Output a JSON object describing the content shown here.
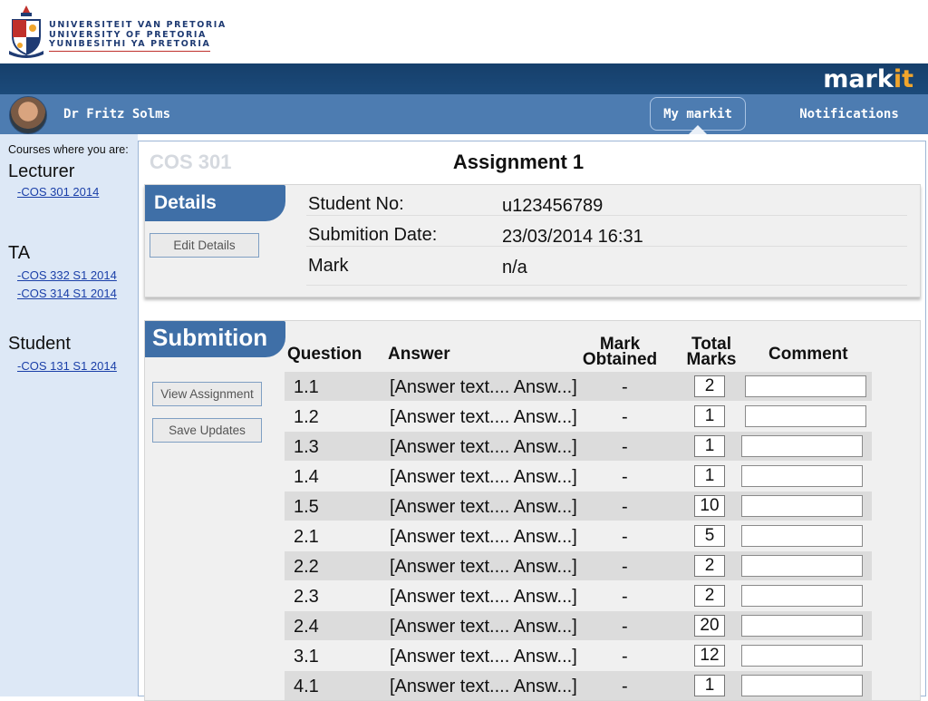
{
  "header": {
    "university_names": [
      "UNIVERSITEIT VAN PRETORIA",
      "UNIVERSITY OF PRETORIA",
      "YUNIBESITHI YA PRETORIA"
    ],
    "brand": {
      "part1": "mark",
      "part2": "it"
    }
  },
  "user_bar": {
    "user_name": "Dr Fritz Solms",
    "nav": {
      "my_markit": "My markit",
      "notifications": "Notifications"
    }
  },
  "sidebar": {
    "intro": "Courses where you are:",
    "roles": [
      {
        "title": "Lecturer",
        "courses": [
          "-COS 301 2014"
        ]
      },
      {
        "title": "TA",
        "courses": [
          "-COS 332 S1 2014",
          "-COS 314 S1 2014"
        ]
      },
      {
        "title": "Student",
        "courses": [
          "-COS 131 S1 2014"
        ]
      }
    ]
  },
  "main": {
    "course_tag": "COS 301",
    "title": "Assignment 1",
    "details": {
      "heading": "Details",
      "edit_button": "Edit Details",
      "rows": [
        {
          "label": "Student No:",
          "value": "u123456789"
        },
        {
          "label": "Submition Date:",
          "value": "23/03/2014  16:31"
        },
        {
          "label": "Mark",
          "value": "n/a"
        }
      ]
    },
    "submission": {
      "heading": "Submition",
      "buttons": {
        "view": "View Assignment",
        "save": "Save Updates"
      },
      "columns": {
        "question": "Question",
        "answer": "Answer",
        "mark_obtained_1": "Mark",
        "mark_obtained_2": "Obtained",
        "total_marks_1": "Total",
        "total_marks_2": "Marks",
        "comment": "Comment"
      },
      "rows": [
        {
          "question": "1.1",
          "answer": "[Answer text.... Answ...]",
          "mark_obtained": "-",
          "total": "2"
        },
        {
          "question": "1.2",
          "answer": "[Answer text.... Answ...]",
          "mark_obtained": "-",
          "total": "1"
        },
        {
          "question": "1.3",
          "answer": "[Answer text.... Answ...]",
          "mark_obtained": "-",
          "total": "1"
        },
        {
          "question": "1.4",
          "answer": "[Answer text.... Answ...]",
          "mark_obtained": "-",
          "total": "1"
        },
        {
          "question": "1.5",
          "answer": "[Answer text.... Answ...]",
          "mark_obtained": "-",
          "total": "10"
        },
        {
          "question": "2.1",
          "answer": "[Answer text.... Answ...]",
          "mark_obtained": "-",
          "total": "5"
        },
        {
          "question": "2.2",
          "answer": "[Answer text.... Answ...]",
          "mark_obtained": "-",
          "total": "2"
        },
        {
          "question": "2.3",
          "answer": "[Answer text.... Answ...]",
          "mark_obtained": "-",
          "total": "2"
        },
        {
          "question": "2.4",
          "answer": "[Answer text.... Answ...]",
          "mark_obtained": "-",
          "total": "20"
        },
        {
          "question": "3.1",
          "answer": "[Answer text.... Answ...]",
          "mark_obtained": "-",
          "total": "12"
        },
        {
          "question": "4.1",
          "answer": "[Answer text.... Answ...]",
          "mark_obtained": "-",
          "total": "1"
        }
      ]
    }
  }
}
